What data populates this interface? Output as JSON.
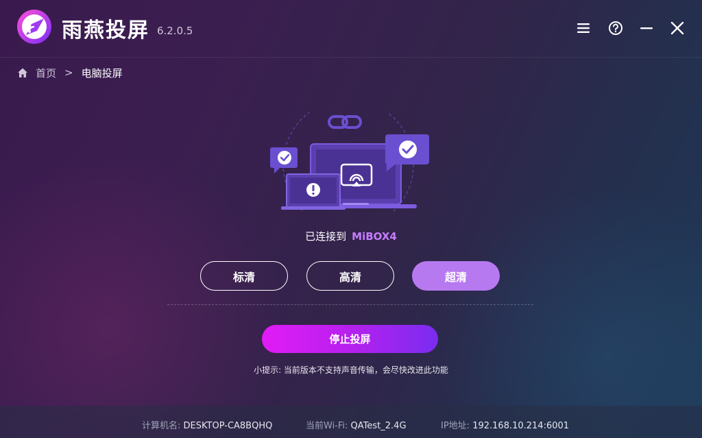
{
  "app": {
    "name": "雨燕投屏",
    "version": "6.2.0.5"
  },
  "window_controls": {
    "menu": "menu-icon",
    "help": "help-icon",
    "minimize": "minimize-icon",
    "close": "close-icon"
  },
  "breadcrumb": {
    "home": "首页",
    "separator": ">",
    "current": "电脑投屏"
  },
  "status": {
    "prefix": "已连接到",
    "device": "MiBOX4"
  },
  "quality": {
    "options": [
      "标清",
      "高清",
      "超清"
    ],
    "selected": "超清"
  },
  "actions": {
    "stop": "停止投屏"
  },
  "tip": "小提示: 当前版本不支持声音传输，会尽快改进此功能",
  "footer": {
    "computer_label": "计算机名:",
    "computer_value": "DESKTOP-CA8BQHQ",
    "wifi_label": "当前Wi-Fi:",
    "wifi_value": "QATest_2.4G",
    "ip_label": "IP地址:",
    "ip_value": "192.168.10.214:6001"
  },
  "colors": {
    "accent": "#c77dff",
    "selected_button": "#b779f0",
    "stop_gradient_start": "#e11cf5",
    "stop_gradient_end": "#7a2cf0",
    "illustration_purple": "#5b3fae"
  }
}
